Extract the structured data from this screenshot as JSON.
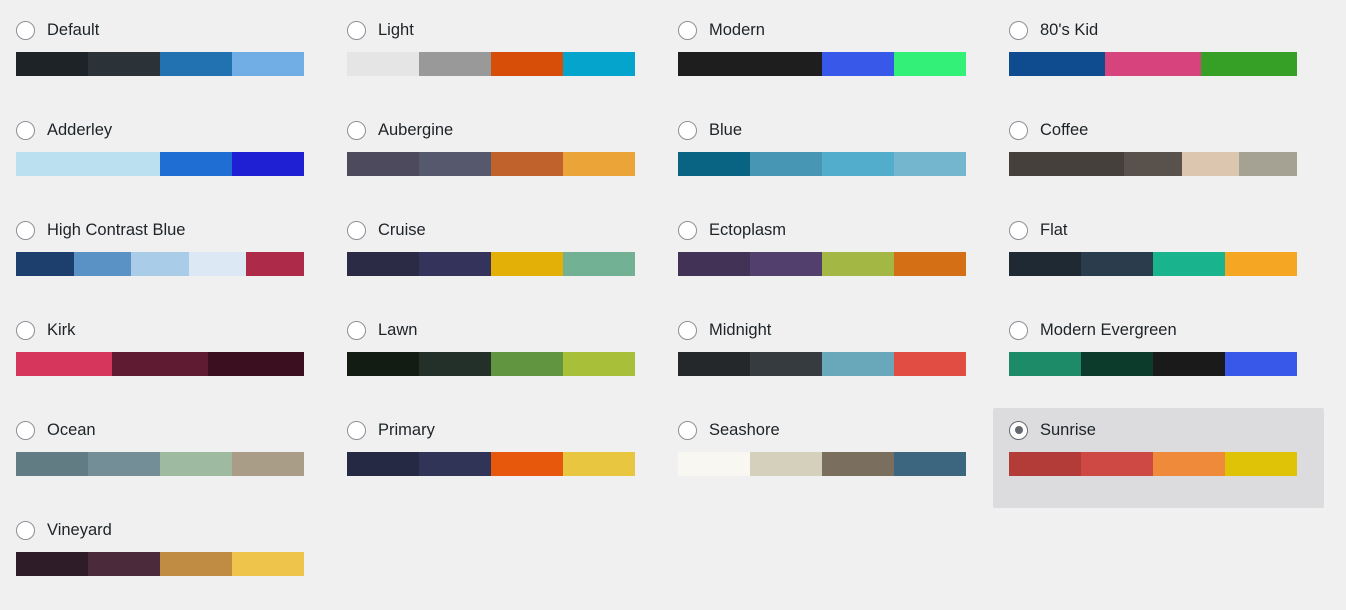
{
  "picker": {
    "selected_scheme": "Sunrise",
    "background_color": "#f0f0f1",
    "selected_highlight_color": "#dcdcde",
    "radio_border_color": "#8c8f94",
    "label_color": "#1d2327",
    "schemes": [
      {
        "name": "Default",
        "selected": false,
        "colors": [
          "#1d2327",
          "#2c3338",
          "#2271b1",
          "#72aee6"
        ],
        "weights": [
          1,
          1,
          1,
          1
        ]
      },
      {
        "name": "Light",
        "selected": false,
        "colors": [
          "#e5e5e5",
          "#999999",
          "#d64e07",
          "#04a4cc"
        ],
        "weights": [
          1,
          1,
          1,
          1
        ]
      },
      {
        "name": "Modern",
        "selected": false,
        "colors": [
          "#1e1e1e",
          "#3858e9",
          "#33f078"
        ],
        "weights": [
          2,
          1,
          1
        ]
      },
      {
        "name": "80's Kid",
        "selected": false,
        "colors": [
          "#0f4b8f",
          "#d7447d",
          "#36a026"
        ],
        "weights": [
          1,
          1,
          1
        ]
      },
      {
        "name": "Adderley",
        "selected": false,
        "colors": [
          "#bbe0ef",
          "#1f6ed4",
          "#1f20d4"
        ],
        "weights": [
          2,
          1,
          1
        ]
      },
      {
        "name": "Aubergine",
        "selected": false,
        "colors": [
          "#4e4a5e",
          "#56596e",
          "#c0622c",
          "#eba437"
        ],
        "weights": [
          1,
          1,
          1,
          1
        ]
      },
      {
        "name": "Blue",
        "selected": false,
        "colors": [
          "#096484",
          "#4796b3",
          "#52accc",
          "#74b6ce"
        ],
        "weights": [
          1,
          1,
          1,
          1
        ]
      },
      {
        "name": "Coffee",
        "selected": false,
        "colors": [
          "#46403c",
          "#59524c",
          "#ddc6af",
          "#a5a294"
        ],
        "weights": [
          2,
          1,
          1
        ]
      },
      {
        "name": "High Contrast Blue",
        "selected": false,
        "colors": [
          "#1d3f6e",
          "#5b92c6",
          "#a9cce8",
          "#dce9f4",
          "#ad2a48"
        ],
        "weights": [
          1,
          1,
          1,
          1,
          1
        ]
      },
      {
        "name": "Cruise",
        "selected": false,
        "colors": [
          "#2b2b45",
          "#33335c",
          "#e3b008",
          "#73b195"
        ],
        "weights": [
          1,
          1,
          1,
          1
        ]
      },
      {
        "name": "Ectoplasm",
        "selected": false,
        "colors": [
          "#413256",
          "#523f6d",
          "#a3b745",
          "#d46f15"
        ],
        "weights": [
          1,
          1,
          1,
          1
        ]
      },
      {
        "name": "Flat",
        "selected": false,
        "colors": [
          "#1f2933",
          "#2b3d4d",
          "#19b38e",
          "#f5a623"
        ],
        "weights": [
          1,
          1,
          1,
          1
        ]
      },
      {
        "name": "Kirk",
        "selected": false,
        "colors": [
          "#d7365c",
          "#5e1b32",
          "#3b0f1f"
        ],
        "weights": [
          1,
          1,
          1
        ]
      },
      {
        "name": "Lawn",
        "selected": false,
        "colors": [
          "#131c13",
          "#23302a",
          "#61953f",
          "#a8bf3a"
        ],
        "weights": [
          1,
          1,
          1,
          1
        ]
      },
      {
        "name": "Midnight",
        "selected": false,
        "colors": [
          "#25282b",
          "#363b3f",
          "#69a8bb",
          "#e14d43"
        ],
        "weights": [
          1,
          1,
          1,
          1
        ]
      },
      {
        "name": "Modern Evergreen",
        "selected": false,
        "colors": [
          "#1d8a68",
          "#0c3b2c",
          "#1a1a1a",
          "#3858e9"
        ],
        "weights": [
          1,
          1,
          1,
          1
        ]
      },
      {
        "name": "Ocean",
        "selected": false,
        "colors": [
          "#627c83",
          "#738e96",
          "#9ebaa0",
          "#aa9d88"
        ],
        "weights": [
          1,
          1,
          1,
          1
        ]
      },
      {
        "name": "Primary",
        "selected": false,
        "colors": [
          "#262944",
          "#303456",
          "#e8580c",
          "#e8c63f"
        ],
        "weights": [
          1,
          1,
          1,
          1
        ]
      },
      {
        "name": "Seashore",
        "selected": false,
        "colors": [
          "#f8f7f2",
          "#d5d0bc",
          "#7a6f5f",
          "#3c6680"
        ],
        "weights": [
          1,
          1,
          1,
          1
        ]
      },
      {
        "name": "Sunrise",
        "selected": true,
        "colors": [
          "#b43c38",
          "#cf4944",
          "#ee8a3a",
          "#dfc306"
        ],
        "weights": [
          1,
          1,
          1,
          1
        ]
      },
      {
        "name": "Vineyard",
        "selected": false,
        "colors": [
          "#2e1c29",
          "#4b2a3c",
          "#c08c43",
          "#eec54a"
        ],
        "weights": [
          1,
          1,
          1,
          1
        ]
      }
    ]
  }
}
